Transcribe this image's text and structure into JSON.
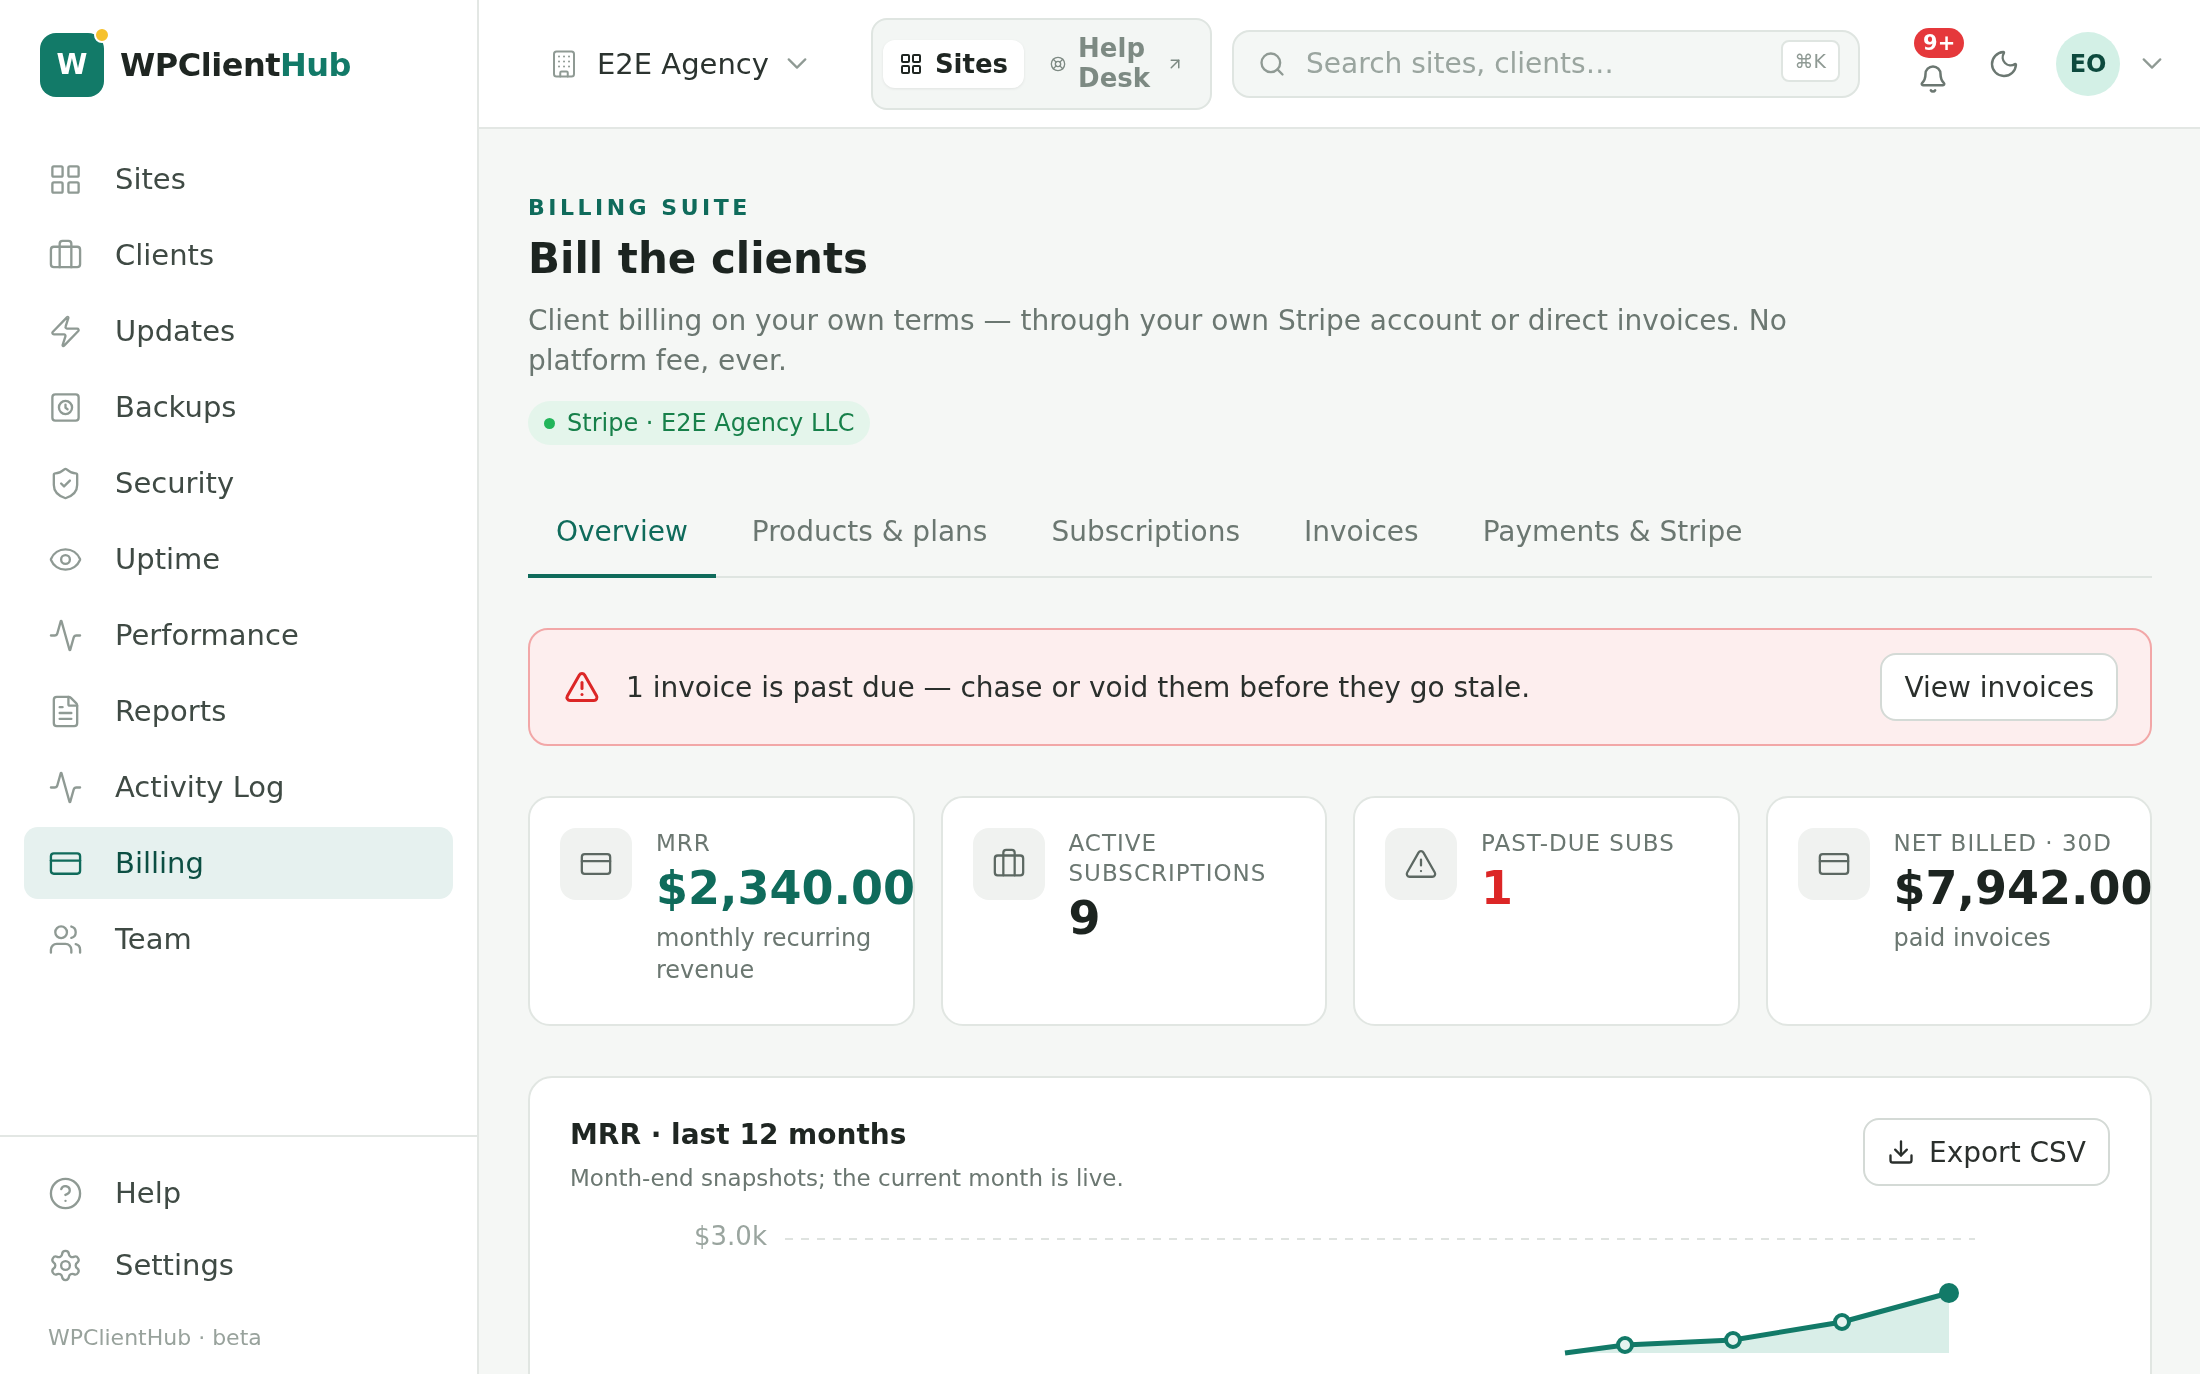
{
  "brand": {
    "name": "WPClient",
    "accent": "Hub",
    "logo_letter": "W"
  },
  "sidebar": {
    "items": [
      {
        "label": "Sites",
        "selected": false
      },
      {
        "label": "Clients",
        "selected": false
      },
      {
        "label": "Updates",
        "selected": false
      },
      {
        "label": "Backups",
        "selected": false
      },
      {
        "label": "Security",
        "selected": false
      },
      {
        "label": "Uptime",
        "selected": false
      },
      {
        "label": "Performance",
        "selected": false
      },
      {
        "label": "Reports",
        "selected": false
      },
      {
        "label": "Activity Log",
        "selected": false
      },
      {
        "label": "Billing",
        "selected": true
      },
      {
        "label": "Team",
        "selected": false
      }
    ],
    "footer_items": [
      {
        "label": "Help"
      },
      {
        "label": "Settings"
      }
    ],
    "footer_note": "WPClientHub · beta"
  },
  "topbar": {
    "workspace": "E2E Agency",
    "switcher": [
      {
        "label": "Sites",
        "selected": true
      },
      {
        "label": "Help Desk",
        "selected": false
      }
    ],
    "search": {
      "placeholder": "Search sites, clients…",
      "shortcut": "⌘K"
    },
    "notifications": "9+",
    "avatar": "EO"
  },
  "header": {
    "eyebrow": "BILLING SUITE",
    "title": "Bill the clients",
    "description": "Client billing on your own terms — through your own Stripe account or direct invoices. No platform fee, ever.",
    "status": "Stripe · E2E Agency LLC"
  },
  "tabs": [
    {
      "label": "Overview",
      "selected": true
    },
    {
      "label": "Products & plans",
      "selected": false
    },
    {
      "label": "Subscriptions",
      "selected": false
    },
    {
      "label": "Invoices",
      "selected": false
    },
    {
      "label": "Payments & Stripe",
      "selected": false
    }
  ],
  "alert": {
    "message": "1 invoice is past due — chase or void them before they go stale.",
    "action": "View invoices"
  },
  "stats": [
    {
      "label": "MRR",
      "value": "$2,340.00",
      "note": "monthly recurring revenue",
      "kind": "accent"
    },
    {
      "label": "ACTIVE SUBSCRIPTIONS",
      "value": "9",
      "kind": "plain"
    },
    {
      "label": "PAST-DUE SUBS",
      "value": "1",
      "kind": "danger"
    },
    {
      "label": "NET BILLED · 30D",
      "value": "$7,942.00",
      "note": "paid invoices",
      "kind": "plain"
    }
  ],
  "chart_card": {
    "title": "MRR · last 12 months",
    "subtitle": "Month-end snapshots; the current month is live.",
    "action": "Export CSV",
    "axis_label": "$3.0k"
  }
}
